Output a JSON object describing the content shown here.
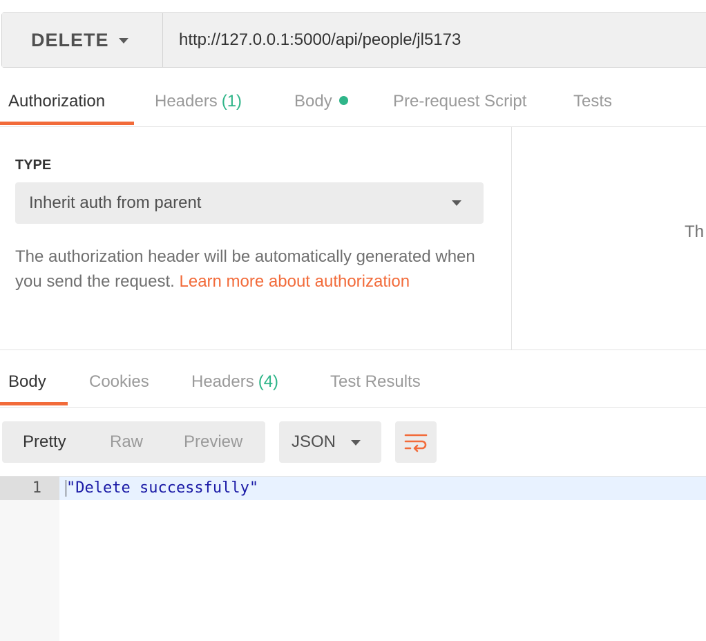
{
  "request": {
    "method": "DELETE",
    "url": "http://127.0.0.1:5000/api/people/jl5173"
  },
  "request_tabs": [
    {
      "label": "Authorization",
      "active": true
    },
    {
      "label": "Headers",
      "count": "(1)"
    },
    {
      "label": "Body",
      "has_content_dot": true
    },
    {
      "label": "Pre-request Script"
    },
    {
      "label": "Tests"
    }
  ],
  "auth": {
    "type_label": "TYPE",
    "type_value": "Inherit auth from parent",
    "help_text": "The authorization header will be automatically generated when you send the request.",
    "help_link": "Learn more about authorization",
    "right_panel_text": "Th"
  },
  "response_tabs": [
    {
      "label": "Body",
      "active": true
    },
    {
      "label": "Cookies"
    },
    {
      "label": "Headers",
      "count": "(4)"
    },
    {
      "label": "Test Results"
    }
  ],
  "response_toolbar": {
    "view_modes": [
      "Pretty",
      "Raw",
      "Preview"
    ],
    "active_view_mode": "Pretty",
    "format": "JSON"
  },
  "response_body": {
    "line_numbers": [
      "1"
    ],
    "lines": [
      "\"Delete successfully\""
    ]
  },
  "colors": {
    "accent": "#f26b3a",
    "count_green": "#2fb589",
    "code_string": "#1a1aa6"
  },
  "icons": {
    "method_dropdown": "chevron-down-icon",
    "auth_dropdown": "chevron-down-icon",
    "format_dropdown": "chevron-down-icon",
    "wrap": "wrap-lines-icon"
  }
}
